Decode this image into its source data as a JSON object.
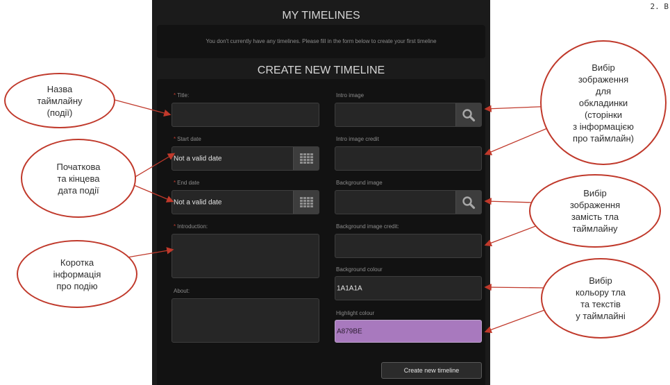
{
  "page_marker": "2. B",
  "app": {
    "my_timelines_title": "MY TIMELINES",
    "notice": "You don't currently have any timelines. Please fill in the form below to create your first timeline",
    "create_title": "CREATE NEW TIMELINE"
  },
  "form": {
    "required_mark": "*",
    "title_label": "Title:",
    "start_date_label": "Start date",
    "start_date_value": "Not a valid date",
    "end_date_label": "End date",
    "end_date_value": "Not a valid date",
    "introduction_label": "Introduction:",
    "about_label": "About:",
    "intro_image_label": "Intro image",
    "intro_image_credit_label": "Intro image credit",
    "background_image_label": "Background image",
    "background_image_credit_label": "Background image credit:",
    "background_colour_label": "Background colour",
    "background_colour_value": "1A1A1A",
    "highlight_colour_label": "Highlight colour",
    "highlight_colour_value": "A879BE",
    "submit_label": "Create new timeline"
  },
  "colors": {
    "panel": "#1b1b1b",
    "highlight_swatch": "#a879be",
    "annotation_outline": "#c0392b"
  },
  "icons": {
    "search": "search-icon",
    "calendar": "calendar-icon"
  },
  "annotations": {
    "title_note": [
      "Назва",
      "таймлайну",
      "(події)"
    ],
    "dates_note": [
      "Початкова",
      "та кінцева",
      "дата події"
    ],
    "intro_note": [
      "Коротка",
      "інформація",
      "про подію"
    ],
    "intro_image_note": [
      "Вибір",
      "зображення",
      "для",
      "обкладинки",
      "(сторінки",
      "з інформацією",
      "про таймлайн)"
    ],
    "bg_image_note": [
      "Вибір",
      "зображення",
      "замість тла",
      "таймлайну"
    ],
    "colour_note": [
      "Вибір",
      "кольору тла",
      "та текстів",
      "у таймлайні"
    ]
  }
}
